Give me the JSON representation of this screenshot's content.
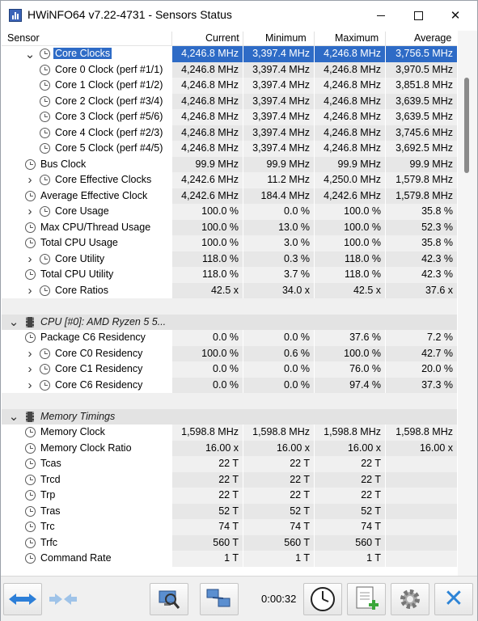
{
  "window": {
    "title": "HWiNFO64 v7.22-4731 - Sensors Status"
  },
  "header": {
    "sensor": "Sensor",
    "current": "Current",
    "minimum": "Minimum",
    "maximum": "Maximum",
    "average": "Average"
  },
  "rows": [
    {
      "name": "Core Clocks",
      "cur": "4,246.8 MHz",
      "min": "3,397.4 MHz",
      "max": "4,246.8 MHz",
      "avg": "3,756.5 MHz"
    },
    {
      "name": "Core 0 Clock (perf #1/1)",
      "cur": "4,246.8 MHz",
      "min": "3,397.4 MHz",
      "max": "4,246.8 MHz",
      "avg": "3,970.5 MHz"
    },
    {
      "name": "Core 1 Clock (perf #1/2)",
      "cur": "4,246.8 MHz",
      "min": "3,397.4 MHz",
      "max": "4,246.8 MHz",
      "avg": "3,851.8 MHz"
    },
    {
      "name": "Core 2 Clock (perf #3/4)",
      "cur": "4,246.8 MHz",
      "min": "3,397.4 MHz",
      "max": "4,246.8 MHz",
      "avg": "3,639.5 MHz"
    },
    {
      "name": "Core 3 Clock (perf #5/6)",
      "cur": "4,246.8 MHz",
      "min": "3,397.4 MHz",
      "max": "4,246.8 MHz",
      "avg": "3,639.5 MHz"
    },
    {
      "name": "Core 4 Clock (perf #2/3)",
      "cur": "4,246.8 MHz",
      "min": "3,397.4 MHz",
      "max": "4,246.8 MHz",
      "avg": "3,745.6 MHz"
    },
    {
      "name": "Core 5 Clock (perf #4/5)",
      "cur": "4,246.8 MHz",
      "min": "3,397.4 MHz",
      "max": "4,246.8 MHz",
      "avg": "3,692.5 MHz"
    },
    {
      "name": "Bus Clock",
      "cur": "99.9 MHz",
      "min": "99.9 MHz",
      "max": "99.9 MHz",
      "avg": "99.9 MHz"
    },
    {
      "name": "Core Effective Clocks",
      "cur": "4,242.6 MHz",
      "min": "11.2 MHz",
      "max": "4,250.0 MHz",
      "avg": "1,579.8 MHz"
    },
    {
      "name": "Average Effective Clock",
      "cur": "4,242.6 MHz",
      "min": "184.4 MHz",
      "max": "4,242.6 MHz",
      "avg": "1,579.8 MHz"
    },
    {
      "name": "Core Usage",
      "cur": "100.0 %",
      "min": "0.0 %",
      "max": "100.0 %",
      "avg": "35.8 %"
    },
    {
      "name": "Max CPU/Thread Usage",
      "cur": "100.0 %",
      "min": "13.0 %",
      "max": "100.0 %",
      "avg": "52.3 %"
    },
    {
      "name": "Total CPU Usage",
      "cur": "100.0 %",
      "min": "3.0 %",
      "max": "100.0 %",
      "avg": "35.8 %"
    },
    {
      "name": "Core Utility",
      "cur": "118.0 %",
      "min": "0.3 %",
      "max": "118.0 %",
      "avg": "42.3 %"
    },
    {
      "name": "Total CPU Utility",
      "cur": "118.0 %",
      "min": "3.7 %",
      "max": "118.0 %",
      "avg": "42.3 %"
    },
    {
      "name": "Core Ratios",
      "cur": "42.5 x",
      "min": "34.0 x",
      "max": "42.5 x",
      "avg": "37.6 x"
    },
    {
      "name": "CPU [#0]: AMD Ryzen 5 5..."
    },
    {
      "name": "Package C6 Residency",
      "cur": "0.0 %",
      "min": "0.0 %",
      "max": "37.6 %",
      "avg": "7.2 %"
    },
    {
      "name": "Core C0 Residency",
      "cur": "100.0 %",
      "min": "0.6 %",
      "max": "100.0 %",
      "avg": "42.7 %"
    },
    {
      "name": "Core C1 Residency",
      "cur": "0.0 %",
      "min": "0.0 %",
      "max": "76.0 %",
      "avg": "20.0 %"
    },
    {
      "name": "Core C6 Residency",
      "cur": "0.0 %",
      "min": "0.0 %",
      "max": "97.4 %",
      "avg": "37.3 %"
    },
    {
      "name": "Memory Timings"
    },
    {
      "name": "Memory Clock",
      "cur": "1,598.8 MHz",
      "min": "1,598.8 MHz",
      "max": "1,598.8 MHz",
      "avg": "1,598.8 MHz"
    },
    {
      "name": "Memory Clock Ratio",
      "cur": "16.00 x",
      "min": "16.00 x",
      "max": "16.00 x",
      "avg": "16.00 x"
    },
    {
      "name": "Tcas",
      "cur": "22 T",
      "min": "22 T",
      "max": "22 T",
      "avg": ""
    },
    {
      "name": "Trcd",
      "cur": "22 T",
      "min": "22 T",
      "max": "22 T",
      "avg": ""
    },
    {
      "name": "Trp",
      "cur": "22 T",
      "min": "22 T",
      "max": "22 T",
      "avg": ""
    },
    {
      "name": "Tras",
      "cur": "52 T",
      "min": "52 T",
      "max": "52 T",
      "avg": ""
    },
    {
      "name": "Trc",
      "cur": "74 T",
      "min": "74 T",
      "max": "74 T",
      "avg": ""
    },
    {
      "name": "Trfc",
      "cur": "560 T",
      "min": "560 T",
      "max": "560 T",
      "avg": ""
    },
    {
      "name": "Command Rate",
      "cur": "1 T",
      "min": "1 T",
      "max": "1 T",
      "avg": ""
    }
  ],
  "toolbar": {
    "elapsed_time": "0:00:32"
  },
  "colors": {
    "selection": "#2e6bc6",
    "close_button": "#2d84d6"
  }
}
